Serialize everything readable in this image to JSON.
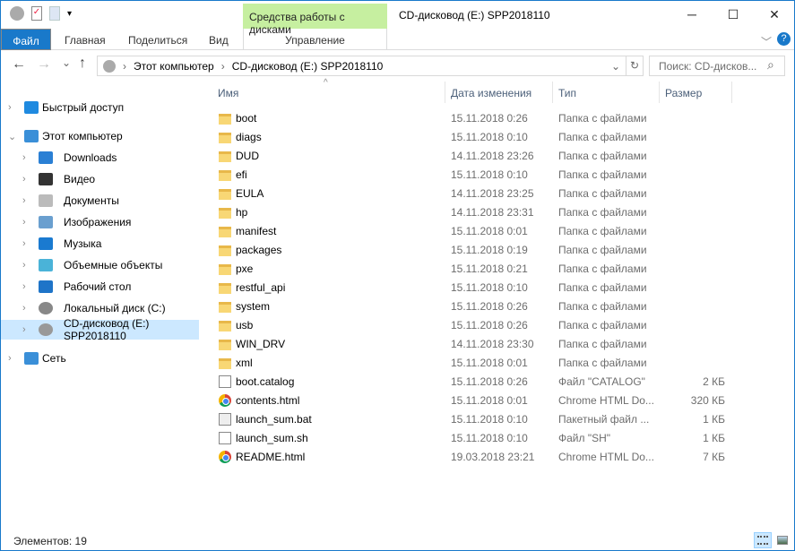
{
  "window": {
    "title": "CD-дисковод (E:) SPP2018110",
    "context_group": "Средства работы с дисками",
    "minimize": "─",
    "maximize": "☐",
    "close": "✕"
  },
  "ribbon": {
    "tabs": [
      "Файл",
      "Главная",
      "Поделиться",
      "Вид"
    ],
    "context_tab": "Управление",
    "collapse": "﹀",
    "help": "?"
  },
  "nav": {
    "back": "←",
    "forward": "→",
    "recent": "⌄",
    "up": "↑",
    "breadcrumb": [
      "Этот компьютер",
      "CD-дисковод (E:) SPP2018110"
    ],
    "dropdown": "⌄",
    "refresh": "↻",
    "search_placeholder": "Поиск: CD-дисков...",
    "search_icon": "⌕"
  },
  "sidebar": [
    {
      "label": "Быстрый доступ",
      "icon": "star-icon",
      "level": 0
    },
    {
      "label": "Этот компьютер",
      "icon": "computer-icon",
      "level": 0,
      "expanded": true
    },
    {
      "label": "Downloads",
      "icon": "download-icon",
      "level": 1
    },
    {
      "label": "Видео",
      "icon": "video-icon",
      "level": 1
    },
    {
      "label": "Документы",
      "icon": "documents-icon",
      "level": 1
    },
    {
      "label": "Изображения",
      "icon": "pictures-icon",
      "level": 1
    },
    {
      "label": "Музыка",
      "icon": "music-icon",
      "level": 1
    },
    {
      "label": "Объемные объекты",
      "icon": "3d-objects-icon",
      "level": 1
    },
    {
      "label": "Рабочий стол",
      "icon": "desktop-icon",
      "level": 1
    },
    {
      "label": "Локальный диск (C:)",
      "icon": "drive-icon",
      "level": 1
    },
    {
      "label": "CD-дисковод (E:) SPP2018110",
      "icon": "cd-drive-icon",
      "level": 1,
      "selected": true
    },
    {
      "label": "Сеть",
      "icon": "network-icon",
      "level": 0
    }
  ],
  "columns": {
    "name": "Имя",
    "date": "Дата изменения",
    "type": "Тип",
    "size": "Размер",
    "sort_indicator": "^"
  },
  "files": [
    {
      "name": "boot",
      "date": "15.11.2018 0:26",
      "type": "Папка с файлами",
      "size": "",
      "kind": "folder"
    },
    {
      "name": "diags",
      "date": "15.11.2018 0:10",
      "type": "Папка с файлами",
      "size": "",
      "kind": "folder"
    },
    {
      "name": "DUD",
      "date": "14.11.2018 23:26",
      "type": "Папка с файлами",
      "size": "",
      "kind": "folder"
    },
    {
      "name": "efi",
      "date": "15.11.2018 0:10",
      "type": "Папка с файлами",
      "size": "",
      "kind": "folder"
    },
    {
      "name": "EULA",
      "date": "14.11.2018 23:25",
      "type": "Папка с файлами",
      "size": "",
      "kind": "folder"
    },
    {
      "name": "hp",
      "date": "14.11.2018 23:31",
      "type": "Папка с файлами",
      "size": "",
      "kind": "folder"
    },
    {
      "name": "manifest",
      "date": "15.11.2018 0:01",
      "type": "Папка с файлами",
      "size": "",
      "kind": "folder"
    },
    {
      "name": "packages",
      "date": "15.11.2018 0:19",
      "type": "Папка с файлами",
      "size": "",
      "kind": "folder"
    },
    {
      "name": "pxe",
      "date": "15.11.2018 0:21",
      "type": "Папка с файлами",
      "size": "",
      "kind": "folder"
    },
    {
      "name": "restful_api",
      "date": "15.11.2018 0:10",
      "type": "Папка с файлами",
      "size": "",
      "kind": "folder"
    },
    {
      "name": "system",
      "date": "15.11.2018 0:26",
      "type": "Папка с файлами",
      "size": "",
      "kind": "folder"
    },
    {
      "name": "usb",
      "date": "15.11.2018 0:26",
      "type": "Папка с файлами",
      "size": "",
      "kind": "folder"
    },
    {
      "name": "WIN_DRV",
      "date": "14.11.2018 23:30",
      "type": "Папка с файлами",
      "size": "",
      "kind": "folder"
    },
    {
      "name": "xml",
      "date": "15.11.2018 0:01",
      "type": "Папка с файлами",
      "size": "",
      "kind": "folder"
    },
    {
      "name": "boot.catalog",
      "date": "15.11.2018 0:26",
      "type": "Файл \"CATALOG\"",
      "size": "2 КБ",
      "kind": "file"
    },
    {
      "name": "contents.html",
      "date": "15.11.2018 0:01",
      "type": "Chrome HTML Do...",
      "size": "320 КБ",
      "kind": "chrome"
    },
    {
      "name": "launch_sum.bat",
      "date": "15.11.2018 0:10",
      "type": "Пакетный файл ...",
      "size": "1 КБ",
      "kind": "bat"
    },
    {
      "name": "launch_sum.sh",
      "date": "15.11.2018 0:10",
      "type": "Файл \"SH\"",
      "size": "1 КБ",
      "kind": "file"
    },
    {
      "name": "README.html",
      "date": "19.03.2018 23:21",
      "type": "Chrome HTML Do...",
      "size": "7 КБ",
      "kind": "chrome"
    }
  ],
  "status": {
    "items": "Элементов: 19"
  }
}
